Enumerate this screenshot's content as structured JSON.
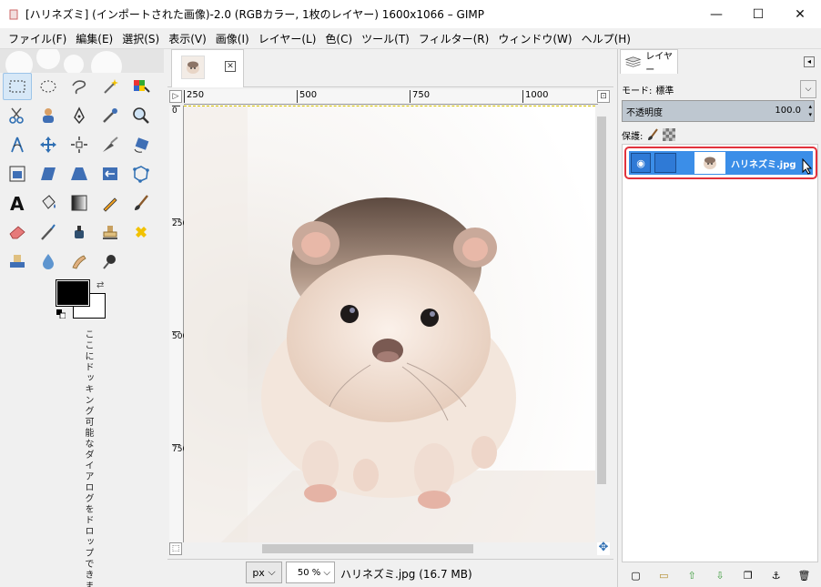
{
  "window": {
    "title": "[ハリネズミ] (インポートされた画像)-2.0 (RGBカラー, 1枚のレイヤー) 1600x1066 – GIMP",
    "minimize": "—",
    "maximize": "☐",
    "close": "✕"
  },
  "menu": [
    "ファイル(F)",
    "編集(E)",
    "選択(S)",
    "表示(V)",
    "画像(I)",
    "レイヤー(L)",
    "色(C)",
    "ツール(T)",
    "フィルター(R)",
    "ウィンドウ(W)",
    "ヘルプ(H)"
  ],
  "toolbox": {
    "tools": [
      "rect-select",
      "ellipse-select",
      "free-select",
      "fuzzy-select",
      "select-by-color",
      "scissors-select",
      "foreground-select",
      "paths",
      "color-picker",
      "zoom",
      "measure",
      "move",
      "alignment",
      "crop",
      "rotate",
      "scale",
      "shear",
      "perspective",
      "flip",
      "cage",
      "text",
      "bucket-fill",
      "blend",
      "pencil",
      "paintbrush",
      "eraser",
      "airbrush",
      "ink",
      "clone",
      "heal",
      "perspective-clone",
      "blur",
      "smudge",
      "dodge-burn"
    ],
    "fg_color": "#000000",
    "bg_color": "#ffffff",
    "dock_hint": "ここにドッキング可能なダイアログをドロップできます"
  },
  "image_window": {
    "ruler_ticks": [
      "250",
      "500",
      "750",
      "1000"
    ],
    "vruler_ticks": [
      "0",
      "250",
      "500",
      "750"
    ],
    "unit": "px",
    "zoom": "50 %",
    "status": "ハリネズミ.jpg (16.7 MB)"
  },
  "layers_dock": {
    "tab_label": "レイヤー",
    "mode_label": "モード:",
    "mode_value": "標準",
    "opacity_label": "不透明度",
    "opacity_value": "100.0",
    "lock_label": "保護:",
    "layer_name": "ハリネズミ.jpg"
  }
}
